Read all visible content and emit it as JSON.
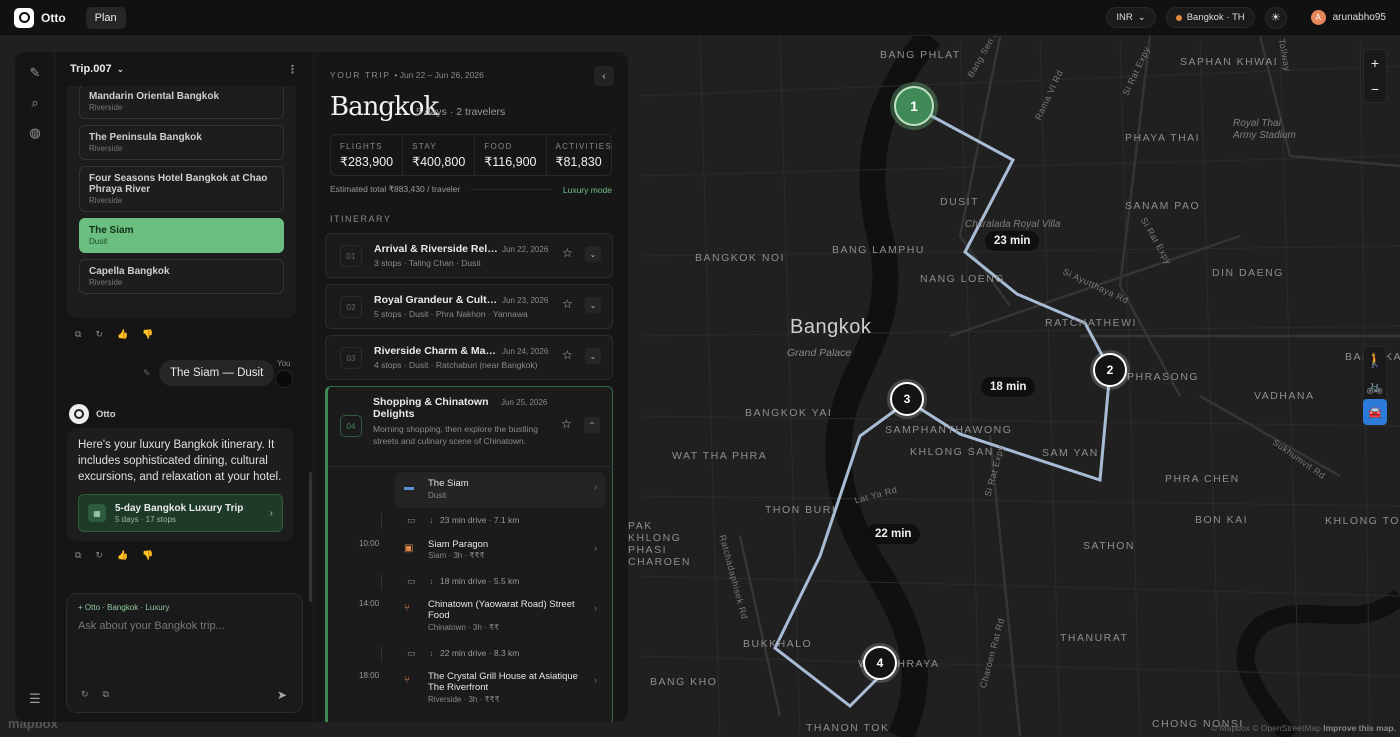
{
  "app": {
    "name": "Otto",
    "plan_label": "Plan"
  },
  "topbar": {
    "currency": "INR",
    "location": "Bangkok · TH",
    "theme_icon": "sun-icon",
    "user_initial": "A",
    "user_name": "arunabho95"
  },
  "chat": {
    "trip_name": "Trip.007",
    "hotels": [
      {
        "name": "Mandarin Oriental Bangkok",
        "area": "Riverside"
      },
      {
        "name": "The Peninsula Bangkok",
        "area": "Riverside"
      },
      {
        "name": "Four Seasons Hotel Bangkok at Chao Phraya River",
        "area": "Riverside"
      },
      {
        "name": "The Siam",
        "area": "Dusit",
        "selected": true
      },
      {
        "name": "Capella Bangkok",
        "area": "Riverside"
      }
    ],
    "user_message": "The Siam — Dusit",
    "you_label": "You",
    "assistant_name": "Otto",
    "assistant_message": "Here's your luxury Bangkok itinerary. It includes sophisticated dining, cultural excursions, and relaxation at your hotel.",
    "trip_card": {
      "title": "5-day Bangkok Luxury Trip",
      "subtitle": "5 days · 17 stops"
    },
    "composer": {
      "context": "Otto · Bangkok · Luxury",
      "placeholder": "Ask about your Bangkok trip..."
    }
  },
  "trip": {
    "label": "YOUR TRIP",
    "dates": "Jun 22 – Jun 26, 2026",
    "city": "Bangkok",
    "meta": "5 days · 2 travelers",
    "budget": [
      {
        "label": "FLIGHTS",
        "value": "₹283,900"
      },
      {
        "label": "STAY",
        "value": "₹400,800"
      },
      {
        "label": "FOOD",
        "value": "₹116,900"
      },
      {
        "label": "ACTIVITIES",
        "value": "₹81,830"
      }
    ],
    "estimate": "Estimated total ₹883,430 / traveler",
    "mode": "Luxury mode",
    "itinerary_label": "ITINERARY",
    "days": [
      {
        "num": "01",
        "title": "Arrival & Riverside Relaxation",
        "date": "Jun 22, 2026",
        "stops": "3 stops · Taling Chan · Dusit"
      },
      {
        "num": "02",
        "title": "Royal Grandeur & Cultural Immersion",
        "date": "Jun 23, 2026",
        "stops": "5 stops · Dusit · Phra Nakhon · Yannawa"
      },
      {
        "num": "03",
        "title": "Riverside Charm & Markets",
        "date": "Jun 24, 2026",
        "stops": "4 stops · Dusit · Ratchaburi (near Bangkok)"
      },
      {
        "num": "04",
        "title": "Shopping & Chinatown Delights",
        "date": "Jun 25, 2026",
        "desc": "Morning shopping, then explore the bustling streets and culinary scene of Chinatown."
      }
    ],
    "stops": [
      {
        "time": "",
        "name": "The Siam",
        "sub": "Dusit"
      },
      {
        "time": "10:00",
        "name": "Siam Paragon",
        "sub": "Siam · 3h · ₹₹₹"
      },
      {
        "time": "14:00",
        "name": "Chinatown (Yaowarat Road) Street Food",
        "sub": "Chinatown · 3h · ₹₹"
      },
      {
        "time": "18:00",
        "name": "The Crystal Grill House at Asiatique The Riverfront",
        "sub": "Riverside · 3h · ₹₹₹"
      }
    ],
    "drives": [
      {
        "text": "23 min drive · 7.1 km"
      },
      {
        "text": "18 min drive · 5.5 km"
      },
      {
        "text": "22 min drive · 8.3 km"
      }
    ]
  },
  "map": {
    "city": "Bangkok",
    "city_sub": "Grand Palace",
    "labels": [
      "BANG PHLAT",
      "SAPHAN KHWAI",
      "PHAYA THAI",
      "DUSIT",
      "SANAM PAO",
      "BANG LAMPHU",
      "NANG LOENG",
      "DIN DAENG",
      "BANGKOK NOI",
      "RATCHATHEWI",
      "BANG KAE",
      "KHLONG SAN",
      "SAMPHANTHAWONG",
      "VADHANA",
      "BANGKOK YAI",
      "WAT THA PHRA",
      "PHRA CHEN",
      "THON BURI",
      "BON KAI",
      "KHLONG TOEI",
      "PAK KHLONG PHASI CHAROEN",
      "SATHON",
      "THANURAT",
      "BANG KHO",
      "BUKKHALO",
      "WAT PHRAYA",
      "THANON TOK",
      "CHONG NONSI",
      "PHAYA THAI"
    ],
    "roads": [
      "Bang Sen Rd",
      "Rama VI Rd",
      "Si Rat Expy",
      "Tollway",
      "Chitralada Royal Villa",
      "Si Rat Expy",
      "Si Ayutthaya Rd",
      "Phrasong",
      "Sukhumvit Rd",
      "Lat Ya Rd",
      "Si Rat Expy",
      "Ratchadaphisek Rd",
      "Charoen Rat Rd",
      "Royal Thai Army Stadium",
      "Sam Yan"
    ],
    "times": [
      "23 min",
      "18 min",
      "22 min"
    ],
    "markers": [
      "1",
      "2",
      "3",
      "4"
    ],
    "zoom_in": "+",
    "zoom_out": "−",
    "attribution": "© Mapbox © OpenStreetMap",
    "improve": "Improve this map.",
    "mapbox": "mapbox"
  }
}
